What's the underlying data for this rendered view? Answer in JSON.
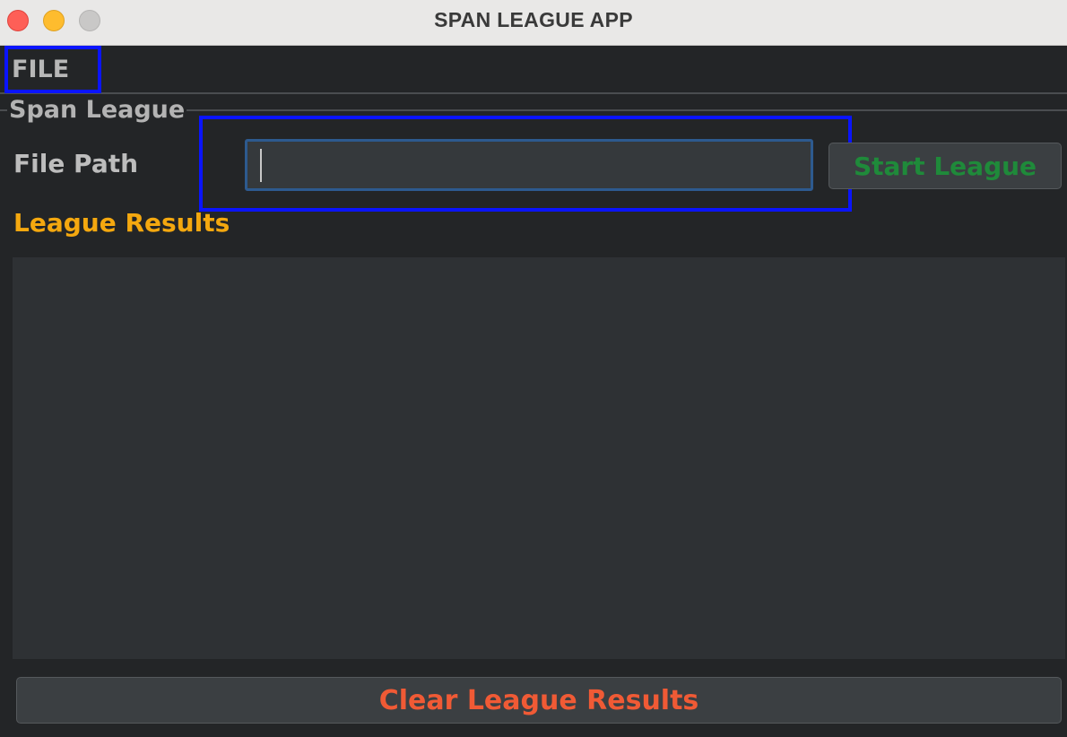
{
  "window": {
    "title": "SPAN LEAGUE APP"
  },
  "menubar": {
    "file_label": "FILE"
  },
  "section": {
    "title": "Span League"
  },
  "form": {
    "file_path_label": "File Path",
    "file_path_value": "",
    "start_button_label": "Start League"
  },
  "results": {
    "label": "League Results",
    "content": ""
  },
  "footer": {
    "clear_button_label": "Clear League Results"
  },
  "colors": {
    "background": "#232527",
    "start_button_text": "#1f8a3a",
    "results_label": "#f4a80f",
    "clear_button_text": "#f05a35",
    "highlight_box": "#0a14ff"
  }
}
